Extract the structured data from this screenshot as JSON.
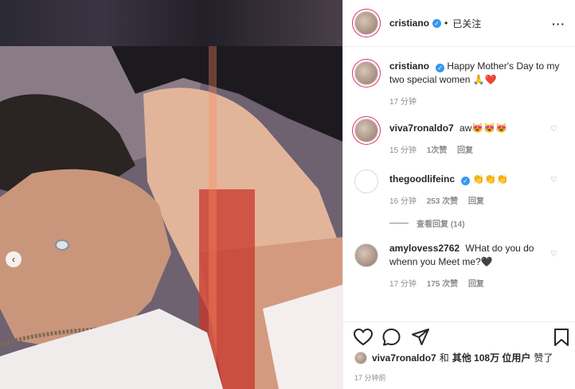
{
  "post": {
    "author": "cristiano",
    "follow_status": "已关注",
    "more_icon": "more-icon",
    "caption": "Happy Mother's Day to my two special women 🙏❤️",
    "caption_time": "17 分钟"
  },
  "comments": [
    {
      "user": "viva7ronaldo7",
      "text": "aw😻😻😻",
      "time": "15 分钟",
      "likes": "1次赞",
      "reply": "回复"
    },
    {
      "user": "thegoodlifeinc",
      "verified": true,
      "text": "👏👏👏",
      "time": "16 分钟",
      "likes": "253 次赞",
      "reply": "回复",
      "view_replies": "查看回复 (14)"
    },
    {
      "user": "amylovess2762",
      "text": "WHat do you do whenn you Meet me?🖤",
      "time": "17 分钟",
      "likes": "175 次赞",
      "reply": "回复"
    }
  ],
  "actions": {
    "like": "heart-icon",
    "comment": "comment-icon",
    "share": "share-icon",
    "save": "bookmark-icon"
  },
  "liked_by": {
    "user": "viva7ronaldo7",
    "and": "和",
    "others": "其他 108万 位用户",
    "liked": "赞了"
  },
  "posted_time": "17 分钟前"
}
